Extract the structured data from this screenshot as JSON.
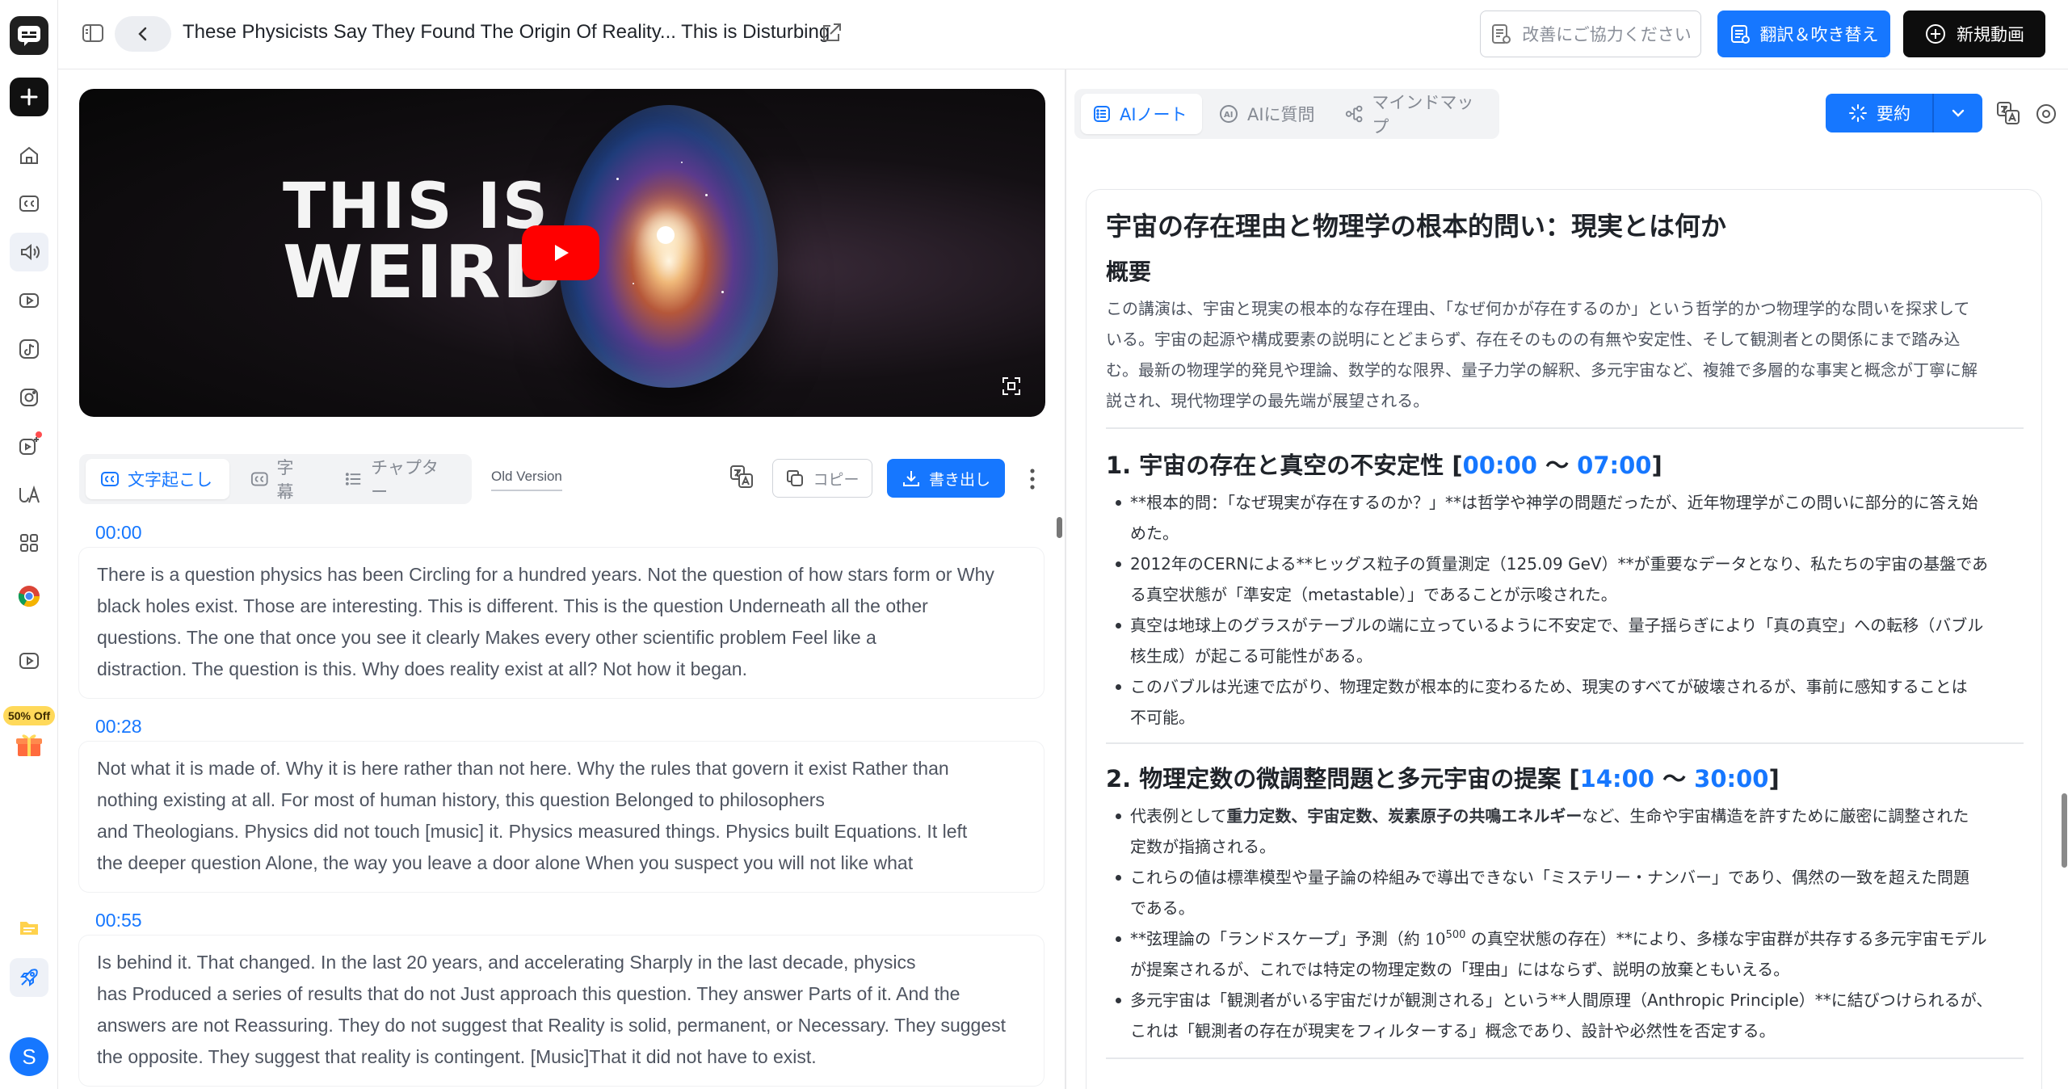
{
  "header": {
    "title": "These Physicists Say They Found The Origin Of Reality... This is Disturbing",
    "feedback_label": "改善にご協力ください",
    "translate_label": "翻訳＆吹き替え",
    "new_video_label": "新規動画"
  },
  "sidebar": {
    "promo_label": "50% Off",
    "avatar_letter": "S"
  },
  "video": {
    "thumbnail_line1": "THIS IS",
    "thumbnail_line2": "WEIRD"
  },
  "left_panel": {
    "tabs": [
      {
        "label": "文字起こし"
      },
      {
        "label": "字幕"
      },
      {
        "label": "チャプター"
      }
    ],
    "old_version_label": "Old Version",
    "copy_label": "コピー",
    "export_label": "書き出し",
    "segments": [
      {
        "time": "00:00",
        "lines": [
          "There is a question physics has been Circling for a hundred years. Not the question of how stars form or Why",
          "black holes exist. Those are interesting. This is different. This is the question Underneath all the other",
          "questions. The one that once you see it clearly Makes every other scientific problem Feel like a",
          "distraction. The question is this. Why does reality exist at all? Not how it began."
        ]
      },
      {
        "time": "00:28",
        "lines": [
          "Not what it is made of. Why it is here rather than not here. Why the rules that govern it exist Rather than",
          "nothing existing at all. For most of human history, this question Belonged to philosophers",
          "and Theologians. Physics did not touch [music] it. Physics measured things. Physics built Equations. It left",
          "the deeper question Alone, the way you leave a door alone When you suspect you will not like what"
        ]
      },
      {
        "time": "00:55",
        "lines": [
          "Is behind it. That changed. In the last 20 years, and accelerating Sharply in the last decade, physics",
          "has Produced a series of results that do not Just approach this question. They answer Parts of it. And the",
          "answers are not Reassuring. They do not suggest that Reality is solid, permanent, or Necessary. They suggest",
          "the opposite. They suggest that reality is contingent. [Music]That it did not have to exist."
        ]
      }
    ]
  },
  "right_panel": {
    "tabs": [
      {
        "label": "AIノート"
      },
      {
        "label": "AIに質問"
      },
      {
        "label": "マインドマップ"
      }
    ],
    "summary_label": "要約",
    "note": {
      "title": "宇宙の存在理由と物理学の根本的問い：現実とは何か",
      "overview_heading": "概要",
      "overview_lines": [
        "この講演は、宇宙と現実の根本的な存在理由、「なぜ何かが存在するのか」という哲学的かつ物理学的な問いを探求して",
        "いる。宇宙の起源や構成要素の説明にとどまらず、存在そのものの有無や安定性、そして観測者との関係にまで踏み込",
        "む。最新の物理学的発見や理論、数学的な限界、量子力学の解釈、多元宇宙など、複雑で多層的な事実と概念が丁寧に解",
        "説され、現代物理学の最先端が展望される。"
      ],
      "sections": [
        {
          "heading_prefix": "1. 宇宙の存在と真空の不安定性 [",
          "start": "00:00",
          "range_sep": " 〜 ",
          "end": "07:00",
          "heading_suffix": "]",
          "bullets": [
            [
              "**根本的問：「なぜ現実が存在するのか？」**は哲学や神学の問題だったが、近年物理学がこの問いに部分的に答え始",
              "めた。"
            ],
            [
              "2012年のCERNによる**ヒッグス粒子の質量測定（125.09 GeV）**が重要なデータとなり、私たちの宇宙の基盤であ",
              "る真空状態が「準安定（metastable）」であることが示唆された。"
            ],
            [
              "真空は地球上のグラスがテーブルの端に立っているように不安定で、量子揺らぎにより「真の真空」への転移（バブル",
              "核生成）が起こる可能性がある。"
            ],
            [
              "このバブルは光速で広がり、物理定数が根本的に変わるため、現実のすべてが破壊されるが、事前に感知することは",
              "不可能。"
            ]
          ]
        },
        {
          "heading_prefix": "2. 物理定数の微調整問題と多元宇宙の提案 [",
          "start": "14:00",
          "range_sep": " 〜 ",
          "end": "30:00",
          "heading_suffix": "]",
          "b1_prefix": "代表例として",
          "b1_bold": "重力定数、宇宙定数、炭素原子の共鳴エネルギー",
          "b1_suffix": "など、生命や宇宙構造を許すために厳密に調整された",
          "b1_line2": "定数が指摘される。",
          "b2": [
            "これらの値は標準模型や量子論の枠組みで導出できない「ミステリー・ナンバー」であり、偶然の一致を超えた問題",
            "である。"
          ],
          "b3_prefix": "**弦理論の「ランドスケープ」予測（約 ",
          "b3_base": "10",
          "b3_exp": "500",
          "b3_suffix": " の真空状態の存在）**により、多様な宇宙群が共存する多元宇宙モデル",
          "b3_line2": "が提案されるが、これでは特定の物理定数の「理由」にはならず、説明の放棄ともいえる。",
          "b4": [
            "多元宇宙は「観測者がいる宇宙だけが観測される」という**人間原理（Anthropic Principle）**に結びつけられるが、",
            "これは「観測者の存在が現実をフィルターする」概念であり、設計や必然性を否定する。"
          ]
        }
      ]
    }
  },
  "colors": {
    "accent": "#1677ff",
    "dark_button": "#0d0d0d",
    "promo": "#ffd95a"
  },
  "icons": [
    "app-logo-icon",
    "plus-icon",
    "home-icon",
    "cc-icon",
    "speaker-icon",
    "play-circle-icon",
    "tiktok-icon",
    "instagram-icon",
    "ai-video-icon",
    "font-icon",
    "apps-icon",
    "chrome-icon",
    "video-icon",
    "gift-icon",
    "folder-icon",
    "rocket-icon",
    "sidebar-toggle-icon",
    "chevron-left-icon",
    "external-link-icon",
    "feedback-icon",
    "translate-doc-icon",
    "plus-circle-icon",
    "youtube-play-icon",
    "fullscreen-icon",
    "list-icon",
    "translate-icon",
    "copy-icon",
    "download-icon",
    "more-icon",
    "ai-icon",
    "mindmap-icon",
    "spinner-icon",
    "chevron-down-icon",
    "gear-icon"
  ]
}
